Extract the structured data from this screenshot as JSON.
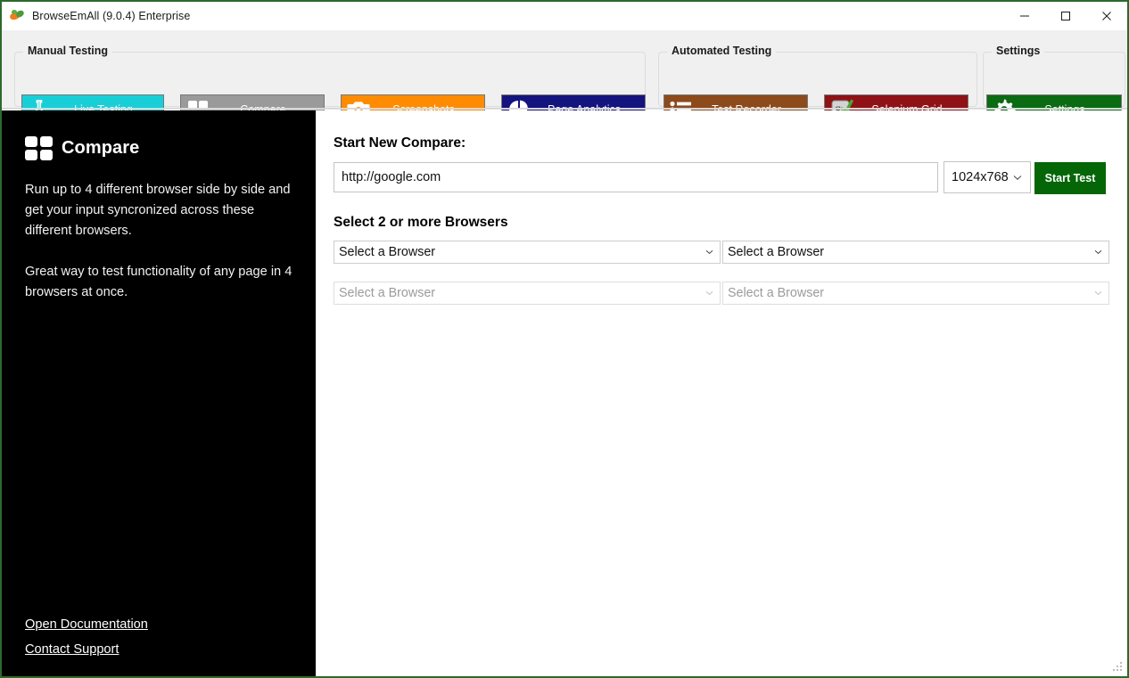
{
  "window": {
    "title": "BrowseEmAll (9.0.4) Enterprise",
    "icon": "browseemall-logo-icon",
    "controls": {
      "minimize": "minimize-icon",
      "maximize": "maximize-icon",
      "close": "close-icon"
    }
  },
  "ribbon": {
    "groups": [
      {
        "title": "Manual Testing"
      },
      {
        "title": "Automated Testing"
      },
      {
        "title": "Settings"
      }
    ],
    "buttons": [
      {
        "label": "Live Testing",
        "icon": "flask-icon",
        "bg": "#18cfd8",
        "fg": "#ffffff",
        "group": "Manual Testing"
      },
      {
        "label": "Compare",
        "icon": "grid-four-icon",
        "bg": "#9a9a9a",
        "fg": "#ffffff",
        "group": "Manual Testing"
      },
      {
        "label": "Screenshots",
        "icon": "camera-icon",
        "bg": "#ff8c00",
        "fg": "#ffffff",
        "group": "Manual Testing"
      },
      {
        "label": "Page Analytics",
        "icon": "pie-chart-icon",
        "bg": "#14147f",
        "fg": "#ffffff",
        "group": "Manual Testing"
      },
      {
        "label": "Test Recorder",
        "icon": "list-bullets-icon",
        "bg": "#8d4a1b",
        "fg": "#ffffff",
        "group": "Automated Testing"
      },
      {
        "label": "Selenium Grid",
        "icon": "selenium-se-icon",
        "bg": "#8f1216",
        "fg": "#ffffff",
        "group": "Automated Testing"
      },
      {
        "label": "Settings",
        "icon": "gear-icon",
        "bg": "#0a6b12",
        "fg": "#ffffff",
        "group": "Settings"
      }
    ]
  },
  "sidebar": {
    "icon": "grid-four-icon",
    "title": "Compare",
    "paragraph1": "Run up to 4 different browser side by side and get your input syncronized across these different browsers.",
    "paragraph2": "Great way to test functionality of any page in 4 browsers at once.",
    "links": [
      {
        "label": "Open Documentation",
        "name": "open-documentation-link"
      },
      {
        "label": "Contact Support",
        "name": "contact-support-link"
      }
    ]
  },
  "main": {
    "start_title": "Start New Compare:",
    "url_value": "http://google.com",
    "url_placeholder": "",
    "resolution_value": "1024x768",
    "start_button": "Start Test",
    "browsers_title": "Select 2 or more Browsers",
    "browser_selects": [
      {
        "value": "Select a Browser",
        "state": "enabled"
      },
      {
        "value": "Select a Browser",
        "state": "enabled"
      },
      {
        "value": "Select a Browser",
        "state": "disabled"
      },
      {
        "value": "Select a Browser",
        "state": "disabled"
      }
    ]
  },
  "colors": {
    "window_border": "#2d6a2d",
    "ribbon_bg": "#f0f0f0",
    "sidebar_bg": "#000000",
    "accent_green": "#056608"
  }
}
